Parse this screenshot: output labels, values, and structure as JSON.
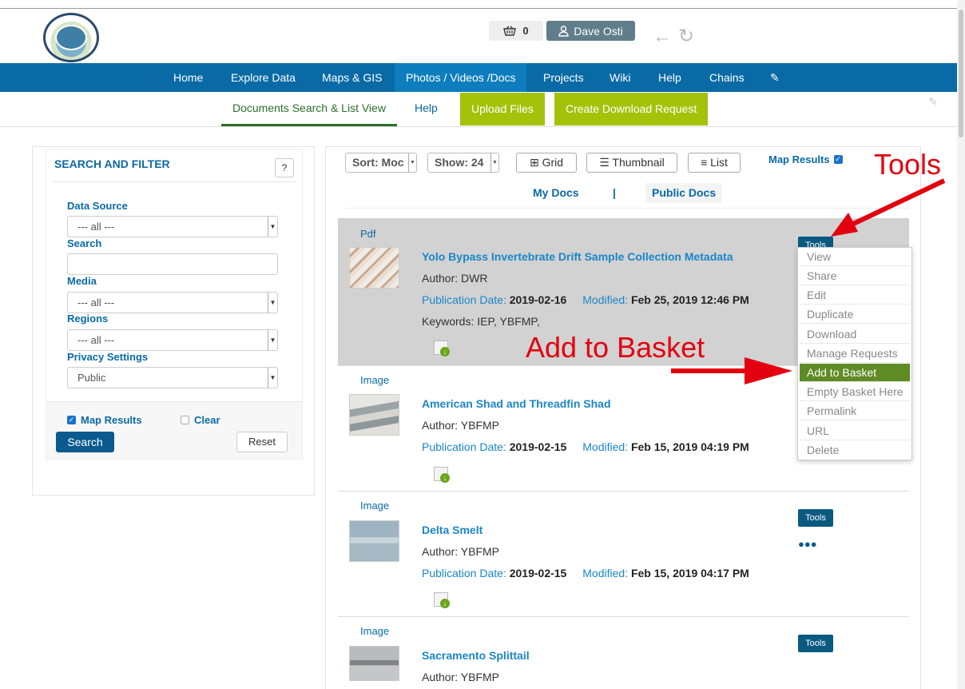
{
  "header": {
    "basket_count": "0",
    "user_name": "Dave Osti"
  },
  "nav": {
    "items": [
      "Home",
      "Explore Data",
      "Maps & GIS",
      "Photos / Videos /Docs",
      "Projects",
      "Wiki",
      "Help",
      "Chains"
    ]
  },
  "subnav": {
    "tab_active": "Documents Search & List View",
    "tab_help": "Help",
    "upload": "Upload Files",
    "create_download": "Create Download Request"
  },
  "sidebar": {
    "title": "SEARCH AND FILTER",
    "help_icon": "?",
    "data_source_label": "Data Source",
    "data_source_value": "--- all ---",
    "search_label": "Search",
    "search_value": "",
    "media_label": "Media",
    "media_value": "--- all ---",
    "regions_label": "Regions",
    "regions_value": "--- all ---",
    "privacy_label": "Privacy Settings",
    "privacy_value": "Public",
    "map_results_label": "Map Results",
    "map_results_checked": true,
    "clear_label": "Clear",
    "clear_checked": false,
    "search_button": "Search",
    "reset_button": "Reset"
  },
  "toolbar": {
    "sort": "Sort: Moc",
    "show": "Show: 24",
    "grid": "Grid",
    "thumbnail": "Thumbnail",
    "list": "List",
    "map_results": "Map Results",
    "my_docs": "My Docs",
    "divider": "|",
    "public_docs": "Public Docs"
  },
  "results": [
    {
      "type": "Pdf",
      "title": "Yolo Bypass Invertebrate Drift Sample Collection Metadata",
      "author": "Author: DWR",
      "pub_label": "Publication Date:",
      "pub_date": "2019-02-16",
      "mod_label": "Modified:",
      "modified": "Feb 25, 2019 12:46 PM",
      "keywords": "Keywords: IEP, YBFMP,",
      "tools": "Tools"
    },
    {
      "type": "Image",
      "title": "American Shad and Threadfin Shad",
      "author": "Author: YBFMP",
      "pub_label": "Publication Date:",
      "pub_date": "2019-02-15",
      "mod_label": "Modified:",
      "modified": "Feb 15, 2019 04:19 PM",
      "tools": "Tools"
    },
    {
      "type": "Image",
      "title": "Delta Smelt",
      "author": "Author: YBFMP",
      "pub_label": "Publication Date:",
      "pub_date": "2019-02-15",
      "mod_label": "Modified:",
      "modified": "Feb 15, 2019 04:17 PM",
      "tools": "Tools"
    },
    {
      "type": "Image",
      "title": "Sacramento Splittail",
      "author": "Author: YBFMP",
      "tools": "Tools"
    }
  ],
  "tools_menu": [
    "View",
    "Share",
    "Edit",
    "Duplicate",
    "Download",
    "Manage Requests",
    "Add to Basket",
    "Empty Basket Here",
    "Permalink",
    "URL",
    "Delete"
  ],
  "tools_menu_active": "Add to Basket",
  "annotations": {
    "tools": "Tools",
    "add_to_basket": "Add to Basket",
    "color": "#e3000f"
  },
  "colors": {
    "nav_bg": "#0a6aa6",
    "accent_green": "#a5c20a",
    "menu_active": "#5e8b24"
  }
}
